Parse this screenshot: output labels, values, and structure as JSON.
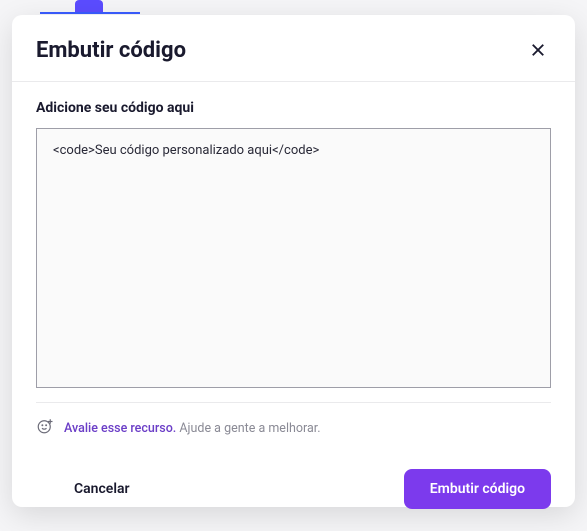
{
  "modal": {
    "title": "Embutir código",
    "fieldLabel": "Adicione seu código aqui",
    "codeValue": "<code>Seu código personalizado aqui</code>",
    "feedback": {
      "linkText": "Avalie esse recurso.",
      "helperText": " Ajude a gente a melhorar."
    },
    "buttons": {
      "cancel": "Cancelar",
      "submit": "Embutir código"
    }
  }
}
